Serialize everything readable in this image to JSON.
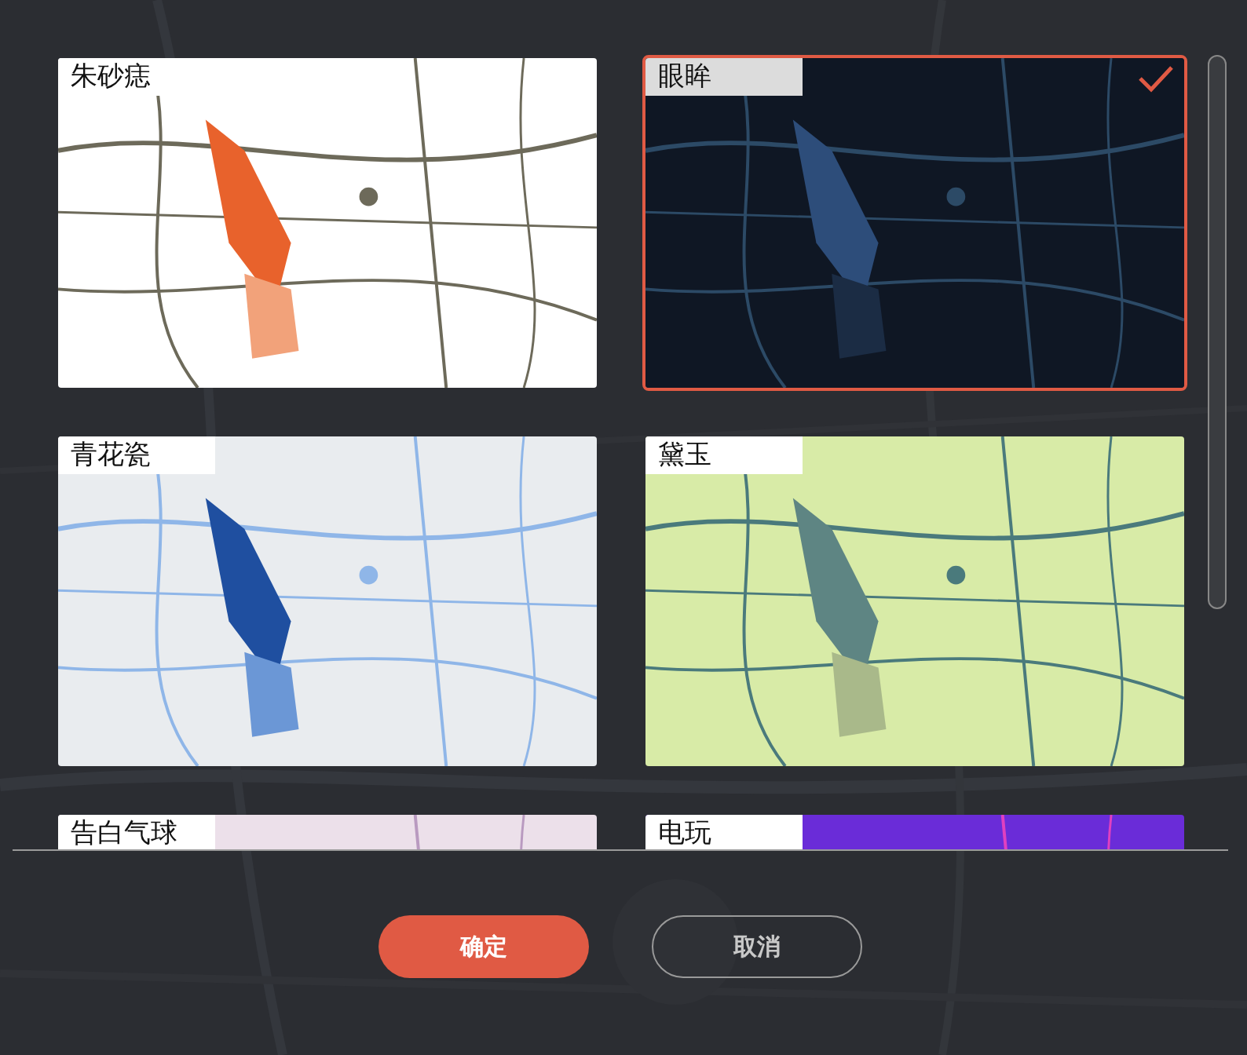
{
  "styles": [
    {
      "name": "朱砂痣",
      "selected": false
    },
    {
      "name": "眼眸",
      "selected": true
    },
    {
      "name": "青花瓷",
      "selected": false
    },
    {
      "name": "黛玉",
      "selected": false
    },
    {
      "name": "告白气球",
      "selected": false
    },
    {
      "name": "电玩",
      "selected": false
    }
  ],
  "buttons": [
    {
      "label": "确定",
      "kind": "primary"
    },
    {
      "label": "取消",
      "kind": "secondary"
    }
  ]
}
